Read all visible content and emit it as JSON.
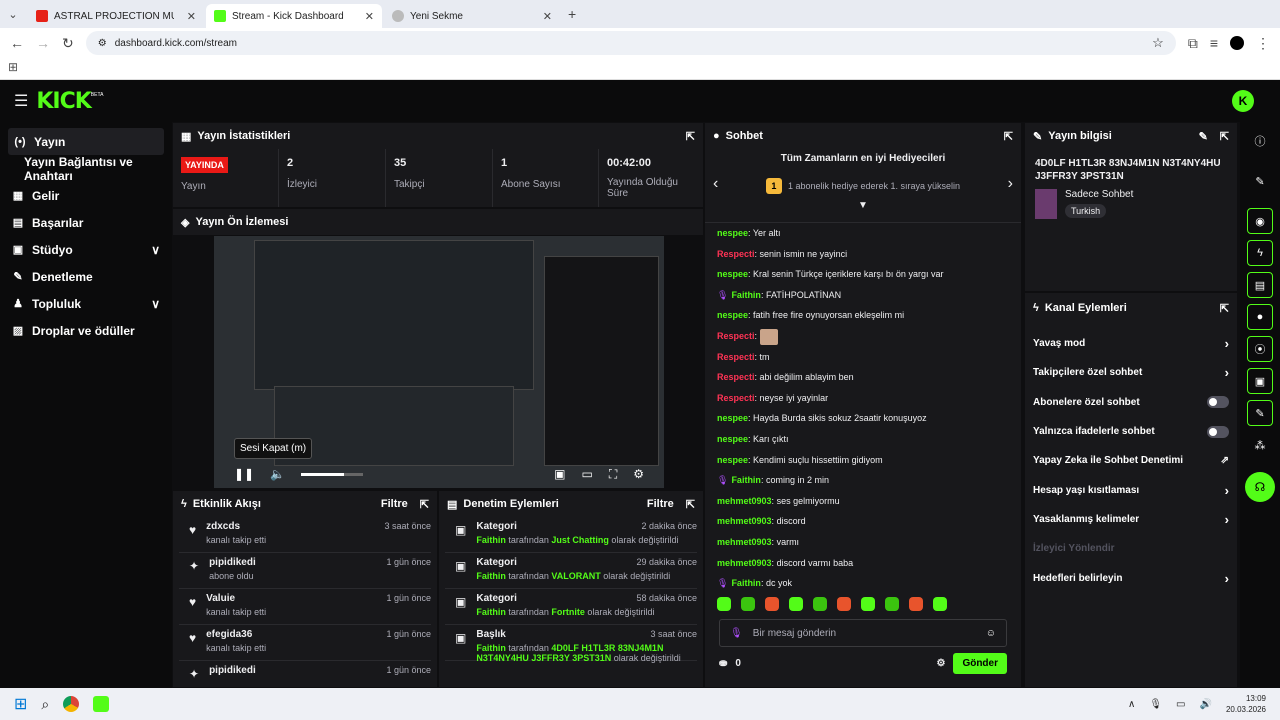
{
  "browser": {
    "tabs": [
      {
        "title": "ASTRAL PROJECTION MUSI",
        "color": "#e62117"
      },
      {
        "title": "Stream - Kick Dashboard",
        "color": "#53fc18"
      },
      {
        "title": "Yeni Sekme",
        "color": "#888888"
      }
    ],
    "url": "dashboard.kick.com/stream"
  },
  "brand": {
    "logo": "KICK",
    "beta": "BETA"
  },
  "sidebar": {
    "items": [
      {
        "label": "Yayın",
        "icon": "(•)"
      },
      {
        "label": "Yayın Bağlantısı ve Anahtarı"
      },
      {
        "label": "Gelir",
        "icon": "▦"
      },
      {
        "label": "Başarılar",
        "icon": "▤"
      },
      {
        "label": "Stüdyo",
        "icon": "▣",
        "chevron": "∨"
      },
      {
        "label": "Denetleme",
        "icon": "✎"
      },
      {
        "label": "Topluluk",
        "icon": "♟",
        "chevron": "∨"
      },
      {
        "label": "Droplar ve ödüller",
        "icon": "▨"
      }
    ]
  },
  "stats": {
    "title": "Yayın İstatistikleri",
    "live_badge": "YAYINDA",
    "live_label": "Yayın",
    "viewers": {
      "value": "2",
      "label": "İzleyici"
    },
    "followers": {
      "value": "35",
      "label": "Takipçi"
    },
    "subs": {
      "value": "1",
      "label": "Abone Sayısı"
    },
    "duration": {
      "value": "00:42:00",
      "label": "Yayında Olduğu Süre"
    }
  },
  "preview": {
    "title": "Yayın Ön İzlemesi",
    "tooltip": "Sesi Kapat (m)",
    "volume": 0.7
  },
  "activity": {
    "title": "Etkinlik Akışı",
    "filter": "Filtre",
    "items": [
      {
        "name": "zdxcds",
        "sub": "kanalı takip etti",
        "time": "3 saat önce",
        "icon": "♥"
      },
      {
        "name": "pipidikedi",
        "sub": "abone oldu",
        "time": "1 gün önce",
        "icon": "✦"
      },
      {
        "name": "Valuie",
        "sub": "kanalı takip etti",
        "time": "1 gün önce",
        "icon": "♥"
      },
      {
        "name": "efegida36",
        "sub": "kanalı takip etti",
        "time": "1 gün önce",
        "icon": "♥"
      },
      {
        "name": "pipidikedi",
        "sub": "",
        "time": "1 gün önce",
        "icon": "✦"
      }
    ]
  },
  "moderation": {
    "title": "Denetim Eylemleri",
    "filter": "Filtre",
    "items": [
      {
        "type": "Kategori",
        "time": "2 dakika önce",
        "by": "Faithin",
        "mid": "tarafından",
        "value": "Just Chatting",
        "tail": "olarak değiştirildi"
      },
      {
        "type": "Kategori",
        "time": "29 dakika önce",
        "by": "Faithin",
        "mid": "tarafından",
        "value": "VALORANT",
        "tail": "olarak değiştirildi"
      },
      {
        "type": "Kategori",
        "time": "58 dakika önce",
        "by": "Faithin",
        "mid": "tarafından",
        "value": "Fortnite",
        "tail": "olarak değiştirildi"
      },
      {
        "type": "Başlık",
        "time": "3 saat önce",
        "by": "Faithin",
        "mid": "tarafından",
        "value": "4D0LF H1TL3R 83NJ4M1N N3T4NY4HU J3FFR3Y 3PST31N",
        "tail": "olarak değiştirildi"
      }
    ]
  },
  "chat": {
    "title": "Sohbet",
    "gifter_title": "Tüm Zamanların en iyi Hediyecileri",
    "gifter_rank": "1",
    "gifter_text": "1 abonelik hediye ederek 1. sıraya yükselin",
    "messages": [
      {
        "user": "nespee",
        "text": "Yer altı",
        "c": "u1"
      },
      {
        "user": "Respecti",
        "text": "senin ismin ne yayinci",
        "c": "u2"
      },
      {
        "user": "nespee",
        "text": "Kral senin Türkçe içeriklere karşı bı ön yargı var",
        "c": "u1"
      },
      {
        "user": "Faithin",
        "text": "FATİHPOLATİNAN",
        "c": "u3",
        "mic": true
      },
      {
        "user": "nespee",
        "text": "fatih free fire oynuyorsan ekleşelim mi",
        "c": "u1"
      },
      {
        "user": "Respecti",
        "text": "",
        "c": "u2",
        "emote": true
      },
      {
        "user": "Respecti",
        "text": "tm",
        "c": "u2"
      },
      {
        "user": "Respecti",
        "text": "abi değilim ablayim ben",
        "c": "u2"
      },
      {
        "user": "Respecti",
        "text": "neyse iyi yayinlar",
        "c": "u2"
      },
      {
        "user": "nespee",
        "text": "Hayda Burda sikis sokuz 2saatir konuşuyoz",
        "c": "u1"
      },
      {
        "user": "nespee",
        "text": "Karı çıktı",
        "c": "u1"
      },
      {
        "user": "nespee",
        "text": "Kendimi suçlu hissettiim gidiyom",
        "c": "u1"
      },
      {
        "user": "Faithin",
        "text": "coming in 2 min",
        "c": "u3",
        "mic": true
      },
      {
        "user": "mehmet0903",
        "text": "ses gelmiyormu",
        "c": "u1"
      },
      {
        "user": "mehmet0903",
        "text": "discord",
        "c": "u1"
      },
      {
        "user": "mehmet0903",
        "text": "varmı",
        "c": "u1"
      },
      {
        "user": "mehmet0903",
        "text": "discord varmı baba",
        "c": "u1"
      },
      {
        "user": "Faithin",
        "text": "dc yok",
        "c": "u3",
        "mic": true
      }
    ],
    "input_placeholder": "Bir mesaj gönderin",
    "points": "0",
    "send": "Gönder"
  },
  "stream_info": {
    "title": "Yayın bilgisi",
    "stream_title": "4D0LF H1TL3R 83NJ4M1N N3T4NY4HU J3FFR3Y 3PST31N",
    "category": "Sadece Sohbet",
    "language": "Turkish"
  },
  "channel_actions": {
    "title": "Kanal Eylemleri",
    "items": [
      {
        "label": "Yavaş mod",
        "kind": "chev"
      },
      {
        "label": "Takipçilere özel sohbet",
        "kind": "chev"
      },
      {
        "label": "Abonelere özel sohbet",
        "kind": "toggle"
      },
      {
        "label": "Yalnızca ifadelerle sohbet",
        "kind": "toggle"
      },
      {
        "label": "Yapay Zeka ile Sohbet Denetimi",
        "kind": "ext"
      },
      {
        "label": "Hesap yaşı kısıtlaması",
        "kind": "chev"
      },
      {
        "label": "Yasaklanmış kelimeler",
        "kind": "chev"
      },
      {
        "label": "İzleyici Yönlendir",
        "kind": "disabled"
      },
      {
        "label": "Hedefleri belirleyin",
        "kind": "chev"
      }
    ]
  },
  "taskbar": {
    "time": "13:09",
    "date": "20.03.2026"
  }
}
